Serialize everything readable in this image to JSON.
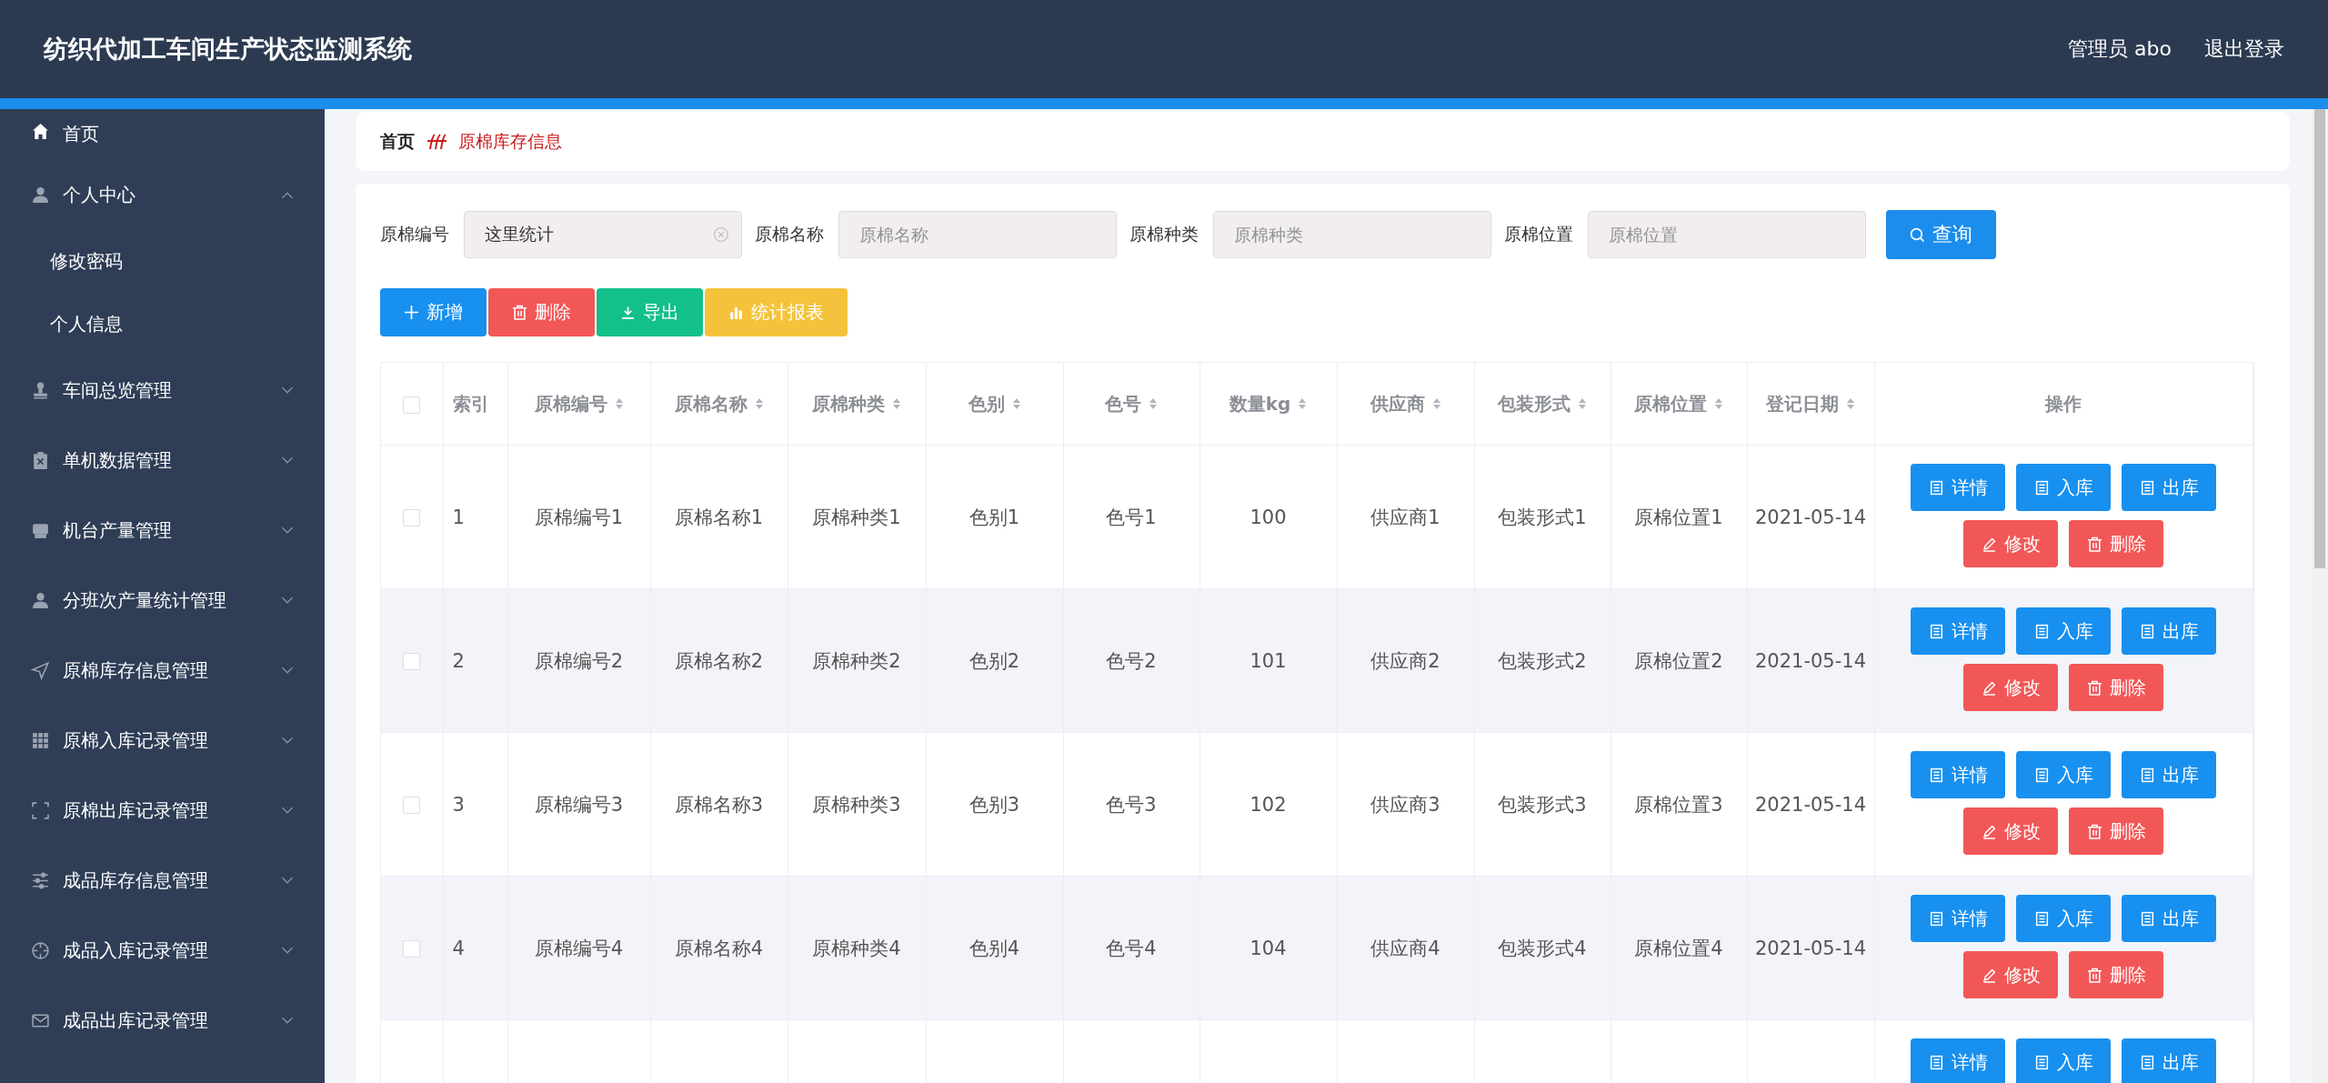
{
  "header": {
    "title": "纺织代加工车间生产状态监测系统",
    "user": "管理员 abo",
    "logout": "退出登录"
  },
  "sidebar": {
    "items": [
      {
        "label": "首页"
      },
      {
        "label": "个人中心",
        "expanded": true,
        "children": [
          {
            "label": "修改密码"
          },
          {
            "label": "个人信息"
          }
        ]
      },
      {
        "label": "车间总览管理",
        "expanded": false
      },
      {
        "label": "单机数据管理",
        "expanded": false
      },
      {
        "label": "机台产量管理",
        "expanded": false
      },
      {
        "label": "分班次产量统计管理",
        "expanded": false
      },
      {
        "label": "原棉库存信息管理",
        "expanded": false
      },
      {
        "label": "原棉入库记录管理",
        "expanded": false
      },
      {
        "label": "原棉出库记录管理",
        "expanded": false
      },
      {
        "label": "成品库存信息管理",
        "expanded": false
      },
      {
        "label": "成品入库记录管理",
        "expanded": false
      },
      {
        "label": "成品出库记录管理",
        "expanded": false
      }
    ]
  },
  "breadcrumb": [
    "首页",
    "原棉库存信息"
  ],
  "search": {
    "fields": [
      {
        "label": "原棉编号",
        "value": "这里统计",
        "clearable": true
      },
      {
        "label": "原棉名称",
        "placeholder": "原棉名称",
        "clearable": false
      },
      {
        "label": "原棉种类",
        "placeholder": "原棉种类",
        "clearable": false
      },
      {
        "label": "原棉位置",
        "placeholder": "原棉位置",
        "clearable": false
      }
    ],
    "button": "查询"
  },
  "toolbar": [
    {
      "kind": "add",
      "label": "新增"
    },
    {
      "kind": "delete",
      "label": "删除"
    },
    {
      "kind": "export",
      "label": "导出"
    },
    {
      "kind": "report",
      "label": "统计报表"
    }
  ],
  "table": {
    "all_checked": false,
    "columns": [
      {
        "label": "索引",
        "sortable": false
      },
      {
        "label": "原棉编号",
        "sortable": true
      },
      {
        "label": "原棉名称",
        "sortable": true
      },
      {
        "label": "原棉种类",
        "sortable": true
      },
      {
        "label": "色别",
        "sortable": true
      },
      {
        "label": "色号",
        "sortable": true
      },
      {
        "label": "数量kg",
        "sortable": true
      },
      {
        "label": "供应商",
        "sortable": true
      },
      {
        "label": "包装形式",
        "sortable": true
      },
      {
        "label": "原棉位置",
        "sortable": true
      },
      {
        "label": "登记日期",
        "sortable": true
      },
      {
        "label": "操作",
        "sortable": false
      }
    ],
    "rows": [
      {
        "checked": false,
        "cells": [
          "1",
          "原棉编号1",
          "原棉名称1",
          "原棉种类1",
          "色别1",
          "色号1",
          "100",
          "供应商1",
          "包装形式1",
          "原棉位置1",
          "2021-05-14"
        ],
        "actions": [
          {
            "kind": "detail",
            "label": "详情"
          },
          {
            "kind": "in",
            "label": "入库"
          },
          {
            "kind": "out",
            "label": "出库"
          },
          {
            "kind": "edit",
            "label": "修改"
          },
          {
            "kind": "delete",
            "label": "删除"
          }
        ]
      },
      {
        "checked": false,
        "cells": [
          "2",
          "原棉编号2",
          "原棉名称2",
          "原棉种类2",
          "色别2",
          "色号2",
          "101",
          "供应商2",
          "包装形式2",
          "原棉位置2",
          "2021-05-14"
        ],
        "actions": [
          {
            "kind": "detail",
            "label": "详情"
          },
          {
            "kind": "in",
            "label": "入库"
          },
          {
            "kind": "out",
            "label": "出库"
          },
          {
            "kind": "edit",
            "label": "修改"
          },
          {
            "kind": "delete",
            "label": "删除"
          }
        ]
      },
      {
        "checked": false,
        "cells": [
          "3",
          "原棉编号3",
          "原棉名称3",
          "原棉种类3",
          "色别3",
          "色号3",
          "102",
          "供应商3",
          "包装形式3",
          "原棉位置3",
          "2021-05-14"
        ],
        "actions": [
          {
            "kind": "detail",
            "label": "详情"
          },
          {
            "kind": "in",
            "label": "入库"
          },
          {
            "kind": "out",
            "label": "出库"
          },
          {
            "kind": "edit",
            "label": "修改"
          },
          {
            "kind": "delete",
            "label": "删除"
          }
        ]
      },
      {
        "checked": false,
        "cells": [
          "4",
          "原棉编号4",
          "原棉名称4",
          "原棉种类4",
          "色别4",
          "色号4",
          "104",
          "供应商4",
          "包装形式4",
          "原棉位置4",
          "2021-05-14"
        ],
        "actions": [
          {
            "kind": "detail",
            "label": "详情"
          },
          {
            "kind": "in",
            "label": "入库"
          },
          {
            "kind": "out",
            "label": "出库"
          },
          {
            "kind": "edit",
            "label": "修改"
          },
          {
            "kind": "delete",
            "label": "删除"
          }
        ]
      },
      {
        "cells": [],
        "actions": [
          {
            "kind": "detail",
            "label": "详情"
          },
          {
            "kind": "in",
            "label": "入库"
          },
          {
            "kind": "out",
            "label": "出库"
          }
        ]
      }
    ]
  }
}
